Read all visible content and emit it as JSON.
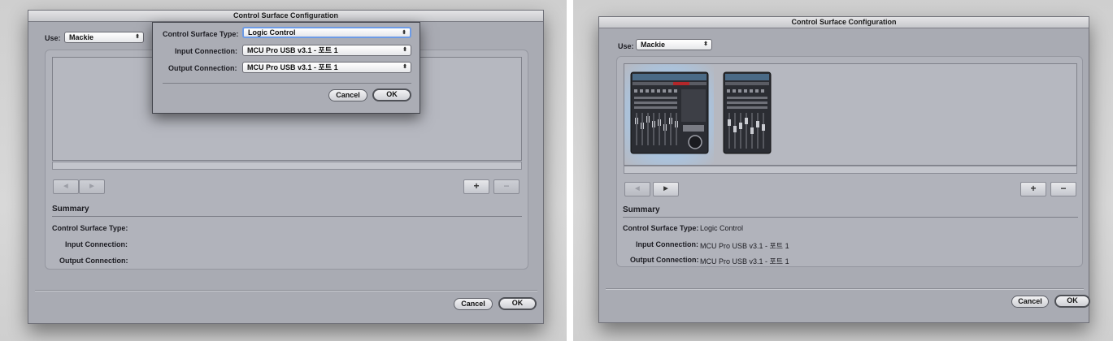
{
  "left_window": {
    "title": "Control Surface Configuration",
    "use_label": "Use:",
    "use_value": "Mackie",
    "summary_heading": "Summary",
    "summary_type_label": "Control Surface Type:",
    "summary_input_label": "Input Connection:",
    "summary_output_label": "Output Connection:",
    "cancel": "Cancel",
    "ok": "OK",
    "add": "+",
    "remove": "−",
    "prev": "◀",
    "next": "▶",
    "sheet": {
      "type_label": "Control Surface Type:",
      "type_value": "Logic Control",
      "input_label": "Input Connection:",
      "input_value": "MCU Pro USB v3.1 - 포트 1",
      "output_label": "Output Connection:",
      "output_value": "MCU Pro USB v3.1 - 포트 1",
      "cancel": "Cancel",
      "ok": "OK"
    }
  },
  "right_window": {
    "title": "Control Surface Configuration",
    "use_label": "Use:",
    "use_value": "Mackie",
    "summary_heading": "Summary",
    "summary_type_label": "Control Surface Type:",
    "summary_type_value": "Logic Control",
    "summary_input_label": "Input Connection:",
    "summary_input_value": "MCU Pro USB v3.1 - 포트 1",
    "summary_output_label": "Output Connection:",
    "summary_output_value": "MCU Pro USB v3.1 - 포트 1",
    "cancel": "Cancel",
    "ok": "OK",
    "add": "+",
    "remove": "−",
    "prev": "◀",
    "next": "▶",
    "devices": [
      "Logic Control",
      "Logic Control XT"
    ]
  },
  "icons": {
    "popup_arrow": "updown-arrows-icon",
    "device_main": "mackie-control-unit-icon",
    "device_ext": "mackie-extender-icon"
  }
}
